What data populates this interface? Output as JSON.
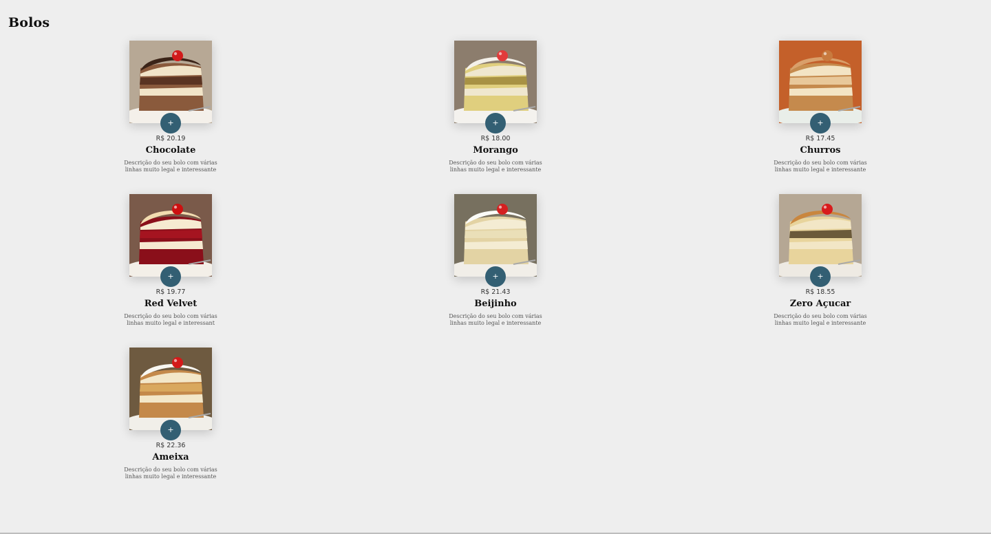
{
  "section": {
    "title": "Bolos"
  },
  "add_label": "+",
  "products": [
    {
      "name": "Chocolate",
      "price": "R$ 20.19",
      "description": "Descrição do seu bolo com várias linhas muito legal e interessante",
      "image": "chocolate-cake-slice",
      "colors": {
        "top": "#3b2418",
        "layer1": "#5a3422",
        "cream": "#f1e4c8",
        "layer2": "#8a5a3c",
        "plate": "#f4f0ea",
        "bg": "#b7a895",
        "cherry": "#d11b1b"
      }
    },
    {
      "name": "Morango",
      "price": "R$ 18.00",
      "description": "Descrição do seu bolo com várias linhas muito legal e interessante",
      "image": "strawberry-cake-slice",
      "colors": {
        "top": "#f4f1ea",
        "layer1": "#a89244",
        "cream": "#efe7cf",
        "layer2": "#e0cf7e",
        "plate": "#f4f2ee",
        "bg": "#8c7d6d",
        "cherry": "#e23b3b"
      }
    },
    {
      "name": "Churros",
      "price": "R$ 17.45",
      "description": "Descrição do seu bolo com várias linhas muito legal e interessante",
      "image": "churros-cake-slice",
      "colors": {
        "top": "#d99f6a",
        "layer1": "#e8c89a",
        "cream": "#f3e4c4",
        "layer2": "#c58a4d",
        "plate": "#e9eee9",
        "bg": "#c4602a",
        "cherry": "#c87a3e"
      }
    },
    {
      "name": "Red Velvet",
      "price": "R$ 19.77",
      "description": "Descrição do seu bolo com várias linhas muito legal e interessant",
      "image": "red-velvet-cake-slice",
      "colors": {
        "top": "#f2dcb0",
        "layer1": "#a51420",
        "cream": "#f6ead1",
        "layer2": "#8a0f1a",
        "plate": "#f3efe8",
        "bg": "#7a5a4a",
        "cherry": "#cc1010"
      }
    },
    {
      "name": "Beijinho",
      "price": "R$ 21.43",
      "description": "Descrição do seu bolo com várias linhas muito legal e interessante",
      "image": "coconut-cake-slice",
      "colors": {
        "top": "#fbfbf7",
        "layer1": "#eadfb8",
        "cream": "#f4ecd3",
        "layer2": "#e3d3a4",
        "plate": "#f1eee8",
        "bg": "#77705f",
        "cherry": "#d42020"
      }
    },
    {
      "name": "Zero Açucar",
      "price": "R$ 18.55",
      "description": "Descrição do seu bolo com várias linhas muito legal e interessante",
      "image": "sugar-free-cake-slice",
      "colors": {
        "top": "#c9863e",
        "layer1": "#6b5a3a",
        "cream": "#f2e6c6",
        "layer2": "#e8d49c",
        "plate": "#eeeae3",
        "bg": "#b5a794",
        "cherry": "#d81c1c"
      }
    },
    {
      "name": "Ameixa",
      "price": "R$ 22.36",
      "description": "Descrição do seu bolo com várias linhas muito legal e interessante",
      "image": "plum-cake-slice",
      "colors": {
        "top": "#f8f7f2",
        "layer1": "#d9a85e",
        "cream": "#f3e7c9",
        "layer2": "#c4894a",
        "plate": "#f1efe9",
        "bg": "#6e5a40",
        "cherry": "#d41a1a"
      }
    }
  ]
}
